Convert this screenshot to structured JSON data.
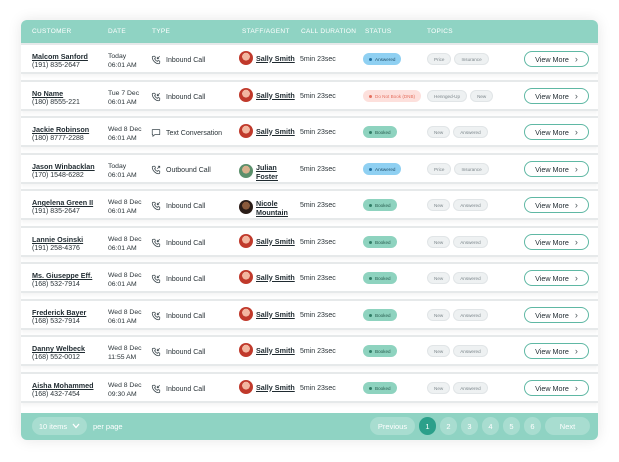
{
  "table": {
    "headers": {
      "customer": "CUSTOMER",
      "date": "DATE",
      "type": "TYPE",
      "staff": "STAFF/AGENT",
      "duration": "CALL DURATION",
      "status": "STATUS",
      "topics": "TOPICS"
    },
    "view_more_label": "View More",
    "rows": [
      {
        "name": "Malcom Sanford",
        "phone": "(191) 835-2647",
        "date": "Today",
        "time": "06:01 AM",
        "type": "Inbound Call",
        "type_icon": "phone-inbound-icon",
        "staff": "Sally Smith",
        "duration": "5min 23sec",
        "status": "Answered",
        "topics": [
          "Price",
          "Insurance"
        ]
      },
      {
        "name": "No Name",
        "phone": "(180) 8555-221",
        "date": "Tue 7 Dec",
        "time": "06:01 AM",
        "type": "Inbound Call",
        "type_icon": "phone-inbound-icon",
        "staff": "Sally Smith",
        "duration": "5min 23sec",
        "status": "Do Not Book (DNB)",
        "topics": [
          "Hennged-Up",
          "New"
        ]
      },
      {
        "name": "Jackie Robinson",
        "phone": "(180) 8777-2288",
        "date": "Wed 8 Dec",
        "time": "06:01 AM",
        "type": "Text Conversation",
        "type_icon": "chat-bubble-icon",
        "staff": "Sally Smith",
        "duration": "5min 23sec",
        "status": "Booked",
        "topics": [
          "New",
          "Answered"
        ]
      },
      {
        "name": "Jason Winbacklan",
        "phone": "(170) 1548-6282",
        "date": "Today",
        "time": "06:01 AM",
        "type": "Outbound Call",
        "type_icon": "phone-outbound-icon",
        "staff": "Julian Foster",
        "duration": "5min 23sec",
        "status": "Answered",
        "topics": [
          "Price",
          "Insurance"
        ]
      },
      {
        "name": "Angelena Green II",
        "phone": "(191) 835-2647",
        "date": "Wed 8 Dec",
        "time": "06:01 AM",
        "type": "Inbound Call",
        "type_icon": "phone-inbound-icon",
        "staff": "Nicole Mountain",
        "duration": "5min 23sec",
        "status": "Booked",
        "topics": [
          "New",
          "Answered"
        ]
      },
      {
        "name": "Lannie Osinski",
        "phone": "(191) 258-4376",
        "date": "Wed 8 Dec",
        "time": "06:01 AM",
        "type": "Inbound Call",
        "type_icon": "phone-inbound-icon",
        "staff": "Sally Smith",
        "duration": "5min 23sec",
        "status": "Booked",
        "topics": [
          "New",
          "Answered"
        ]
      },
      {
        "name": "Ms. Giuseppe Eff.",
        "phone": "(168) 532-7914",
        "date": "Wed 8 Dec",
        "time": "06:01 AM",
        "type": "Inbound Call",
        "type_icon": "phone-inbound-icon",
        "staff": "Sally Smith",
        "duration": "5min 23sec",
        "status": "Booked",
        "topics": [
          "New",
          "Answered"
        ]
      },
      {
        "name": "Frederick Bayer",
        "phone": "(168) 532-7914",
        "date": "Wed 8 Dec",
        "time": "06:01 AM",
        "type": "Inbound Call",
        "type_icon": "phone-inbound-icon",
        "staff": "Sally Smith",
        "duration": "5min 23sec",
        "status": "Booked",
        "topics": [
          "New",
          "Answered"
        ]
      },
      {
        "name": "Danny Welbeck",
        "phone": "(168) 552-0012",
        "date": "Wed 8 Dec",
        "time": "11:55 AM",
        "type": "Inbound Call",
        "type_icon": "phone-inbound-icon",
        "staff": "Sally Smith",
        "duration": "5min 23sec",
        "status": "Booked",
        "topics": [
          "New",
          "Answered"
        ]
      },
      {
        "name": "Aisha Mohammed",
        "phone": "(168) 432-7454",
        "date": "Wed 8 Dec",
        "time": "09:30 AM",
        "type": "Inbound Call",
        "type_icon": "phone-inbound-icon",
        "staff": "Sally Smith",
        "duration": "5min 23sec",
        "status": "Booked",
        "topics": [
          "New",
          "Answered"
        ]
      }
    ]
  },
  "footer": {
    "items_select": "10 items",
    "per_page_label": "per page",
    "previous_label": "Previous",
    "next_label": "Next",
    "pages": [
      "1",
      "2",
      "3",
      "4",
      "5",
      "6"
    ],
    "current_page": "1"
  },
  "colors": {
    "header_bg": "#8fd3c3",
    "answered": "#8fd0f2",
    "booked": "#8ed3bf",
    "dnb": "#fde0dc",
    "active_page": "#2ba08a"
  }
}
